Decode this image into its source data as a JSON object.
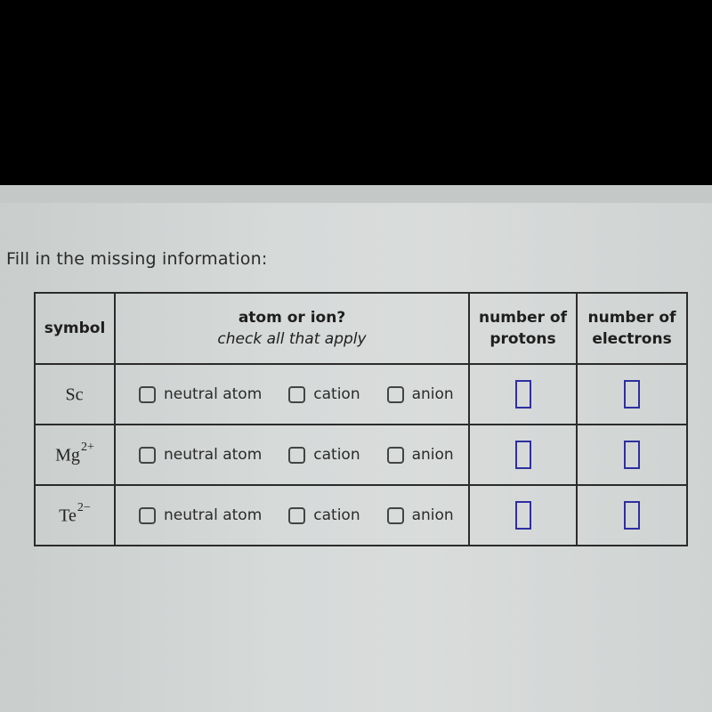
{
  "prompt": "Fill in the missing information:",
  "table": {
    "headers": {
      "symbol": "symbol",
      "atom_or_ion": "atom or ion?",
      "atom_or_ion_sub": "check all that apply",
      "protons": [
        "number of",
        "protons"
      ],
      "electrons": [
        "number of",
        "electrons"
      ]
    },
    "options": [
      "neutral atom",
      "cation",
      "anion"
    ],
    "rows": [
      {
        "symbol": "Sc",
        "charge": "",
        "checked": {
          "neutral atom": false,
          "cation": false,
          "anion": false
        },
        "protons": "",
        "electrons": ""
      },
      {
        "symbol": "Mg",
        "charge": "2+",
        "checked": {
          "neutral atom": false,
          "cation": false,
          "anion": false
        },
        "protons": "",
        "electrons": ""
      },
      {
        "symbol": "Te",
        "charge": "2−",
        "checked": {
          "neutral atom": false,
          "cation": false,
          "anion": false
        },
        "protons": "",
        "electrons": ""
      }
    ]
  },
  "colors": {
    "input_border": "#2e2fa0",
    "grid_lines": "#2b2b2b",
    "background": "#d6dad9"
  }
}
